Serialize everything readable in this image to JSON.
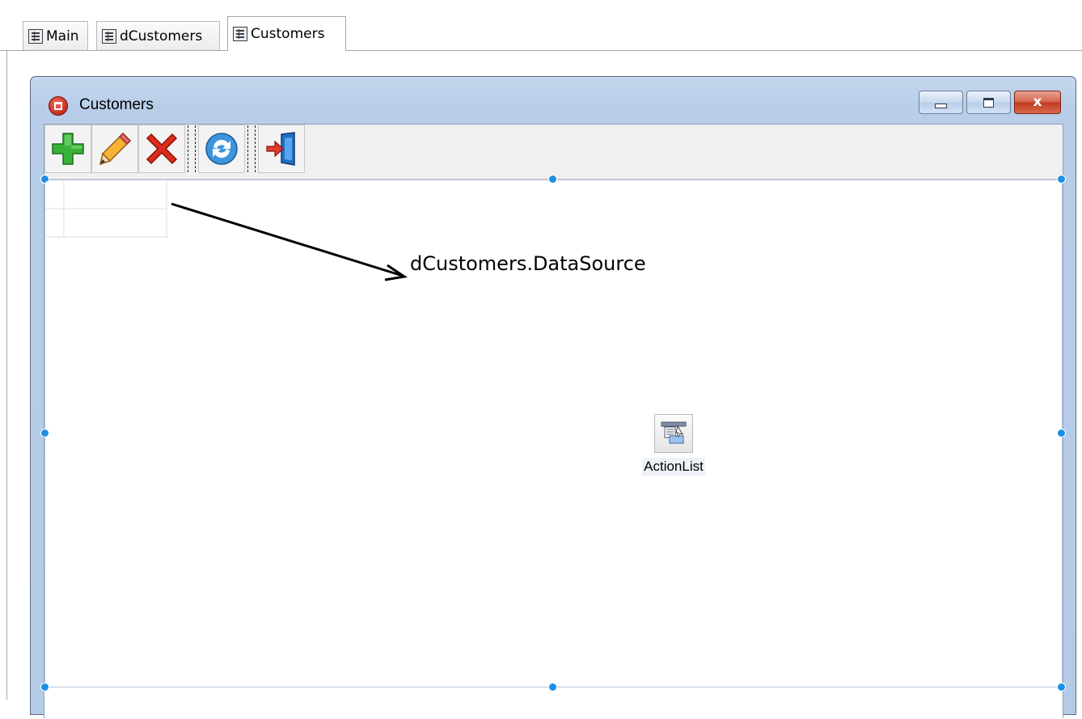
{
  "tabs": [
    {
      "label": "Main",
      "icon": "form-icon"
    },
    {
      "label": "dCustomers",
      "icon": "form-icon"
    },
    {
      "label": "Customers",
      "icon": "form-icon",
      "active": true
    }
  ],
  "window": {
    "title": "Customers",
    "icon": "app-icon",
    "caption_buttons": [
      "minimize",
      "maximize",
      "close"
    ],
    "close_glyph": "x"
  },
  "toolbar": {
    "buttons": [
      {
        "name": "add",
        "icon": "plus-icon",
        "color": "#2fa12f"
      },
      {
        "name": "edit",
        "icon": "pencil-icon",
        "color": "#f2a42a"
      },
      {
        "name": "delete",
        "icon": "x-icon",
        "color": "#d32318"
      },
      {
        "name": "refresh",
        "icon": "refresh-icon",
        "color": "#2b8ad8"
      },
      {
        "name": "exit",
        "icon": "exit-door-icon",
        "color": "#1f6fc4"
      }
    ]
  },
  "annotation": {
    "text": "dCustomers.DataSource"
  },
  "component": {
    "label": "ActionList",
    "icon": "actionlist-icon"
  }
}
